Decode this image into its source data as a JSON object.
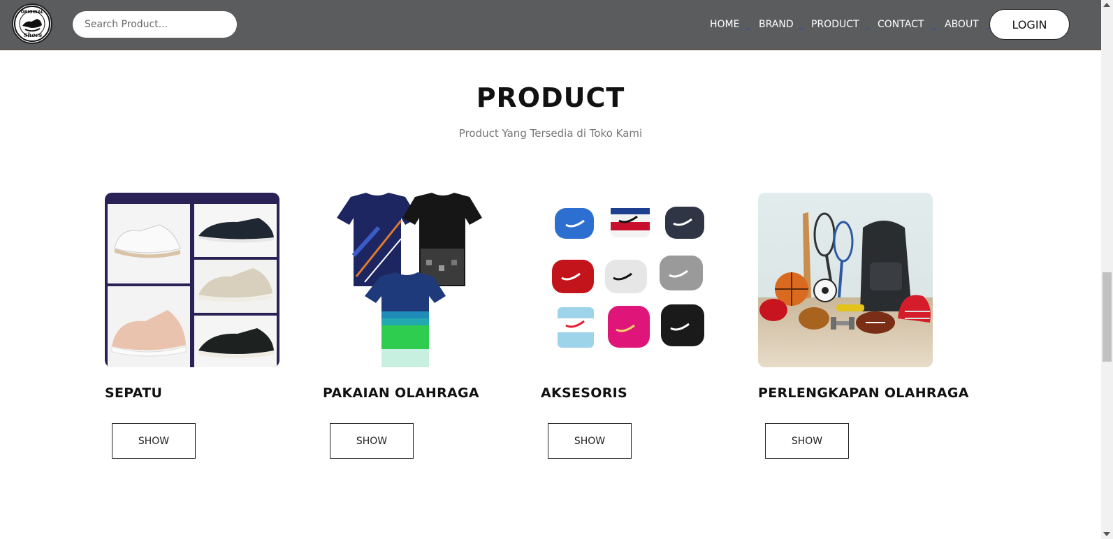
{
  "header": {
    "logo_alt": "Original Shoes",
    "search": {
      "placeholder": "Search Product..."
    },
    "nav": [
      {
        "label": "HOME"
      },
      {
        "label": "BRAND"
      },
      {
        "label": "PRODUCT"
      },
      {
        "label": "CONTACT"
      },
      {
        "label": "ABOUT"
      }
    ],
    "login_label": "LOGIN"
  },
  "section": {
    "title": "PRODUCT",
    "subtitle": "Product Yang Tersedia di Toko Kami"
  },
  "products": [
    {
      "name": "SEPATU",
      "button": "SHOW",
      "image": "shoes-collage"
    },
    {
      "name": "PAKAIAN OLAHRAGA",
      "button": "SHOW",
      "image": "sport-jerseys"
    },
    {
      "name": "AKSESORIS",
      "button": "SHOW",
      "image": "wristbands"
    },
    {
      "name": "PERLENGKAPAN OLAHRAGA",
      "button": "SHOW",
      "image": "sports-equipment"
    }
  ],
  "colors": {
    "navbar_bg": "#5b5c5e",
    "nav_text": "#ffffff",
    "nav_separator": "#2b3fbf",
    "title_text": "#111111",
    "subtitle_text": "#777777"
  }
}
